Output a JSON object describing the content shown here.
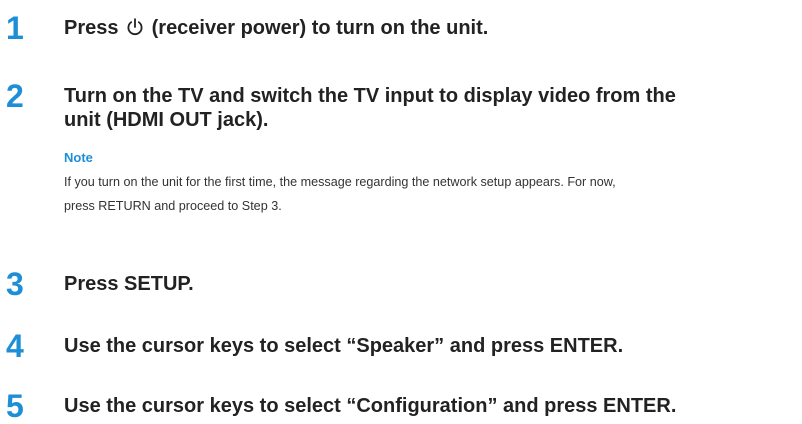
{
  "colors": {
    "step_number": "#1e8fd6",
    "note_label": "#1e8fd6",
    "step_text": "#222222",
    "note_text": "#333333"
  },
  "steps": [
    {
      "number": "1",
      "before_icon": "Press ",
      "icon": "power-icon",
      "after_icon": " (receiver power) to turn on the unit."
    },
    {
      "number": "2",
      "lines": [
        "Turn on the TV and switch the TV input to display video from the",
        "unit (HDMI OUT jack)."
      ]
    },
    {
      "number": "3",
      "text": "Press SETUP."
    },
    {
      "number": "4",
      "text": "Use the cursor keys to select “Speaker” and press ENTER."
    },
    {
      "number": "5",
      "text": "Use the cursor keys to select “Configuration” and press ENTER."
    }
  ],
  "note": {
    "label": "Note",
    "lines": [
      "If you turn on the unit for the first time, the message regarding the network setup appears. For now,",
      "press RETURN and proceed to Step 3."
    ]
  }
}
